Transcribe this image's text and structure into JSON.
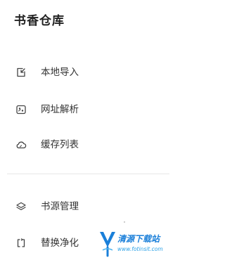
{
  "drawer": {
    "title": "书香仓库",
    "items": [
      {
        "label": "本地导入",
        "icon": "import-icon"
      },
      {
        "label": "网址解析",
        "icon": "url-parse-icon"
      },
      {
        "label": "缓存列表",
        "icon": "cloud-icon"
      },
      {
        "label": "书源管理",
        "icon": "layers-icon"
      },
      {
        "label": "替换净化",
        "icon": "replace-icon"
      }
    ]
  },
  "watermark": {
    "name": "清源下载站",
    "url": "www.fotinsit.com"
  },
  "colors": {
    "text": "#333333",
    "title": "#222222",
    "divider": "#e6e6e6",
    "watermark": "#1a7fd9"
  }
}
